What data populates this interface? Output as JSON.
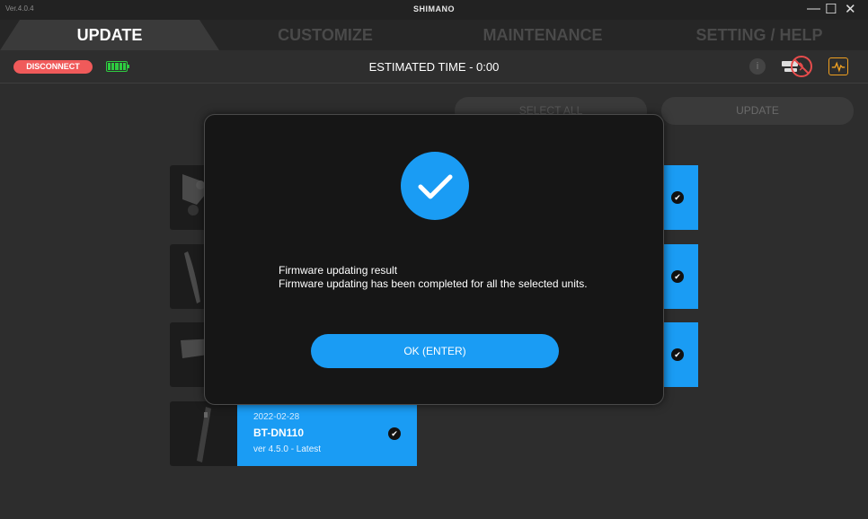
{
  "window": {
    "version": "Ver.4.0.4",
    "brand": "SHIMANO",
    "controls": {
      "minimize": "—",
      "maximize": "☐",
      "close": "✕"
    }
  },
  "tabs": [
    {
      "label": "UPDATE",
      "active": true
    },
    {
      "label": "CUSTOMIZE",
      "active": false
    },
    {
      "label": "MAINTENANCE",
      "active": false
    },
    {
      "label": "SETTING / HELP",
      "active": false
    }
  ],
  "status": {
    "disconnect_label": "DISCONNECT",
    "battery_icon": "battery-full-icon",
    "estimated_time": "ESTIMATED TIME - 0:00",
    "info_icon": "info-icon",
    "info_glyph": "i",
    "connection_icon": "wireless-disabled-icon",
    "monitor_icon": "waveform-icon"
  },
  "actions": {
    "select_all_label": "SELECT ALL",
    "update_label": "UPDATE"
  },
  "units": [
    {
      "date": "2022-02-28",
      "name": "BT-DN110",
      "version": "ver 4.5.0 - Latest",
      "checked": true
    }
  ],
  "modal": {
    "icon": "check-circle-icon",
    "title": "Firmware updating result",
    "message": "Firmware updating has been completed for all the selected units.",
    "ok_label": "OK (ENTER)"
  },
  "colors": {
    "accent": "#1a9cf4",
    "danger": "#f05a5a",
    "battery": "#2ecc40",
    "warning": "#f0a020"
  }
}
